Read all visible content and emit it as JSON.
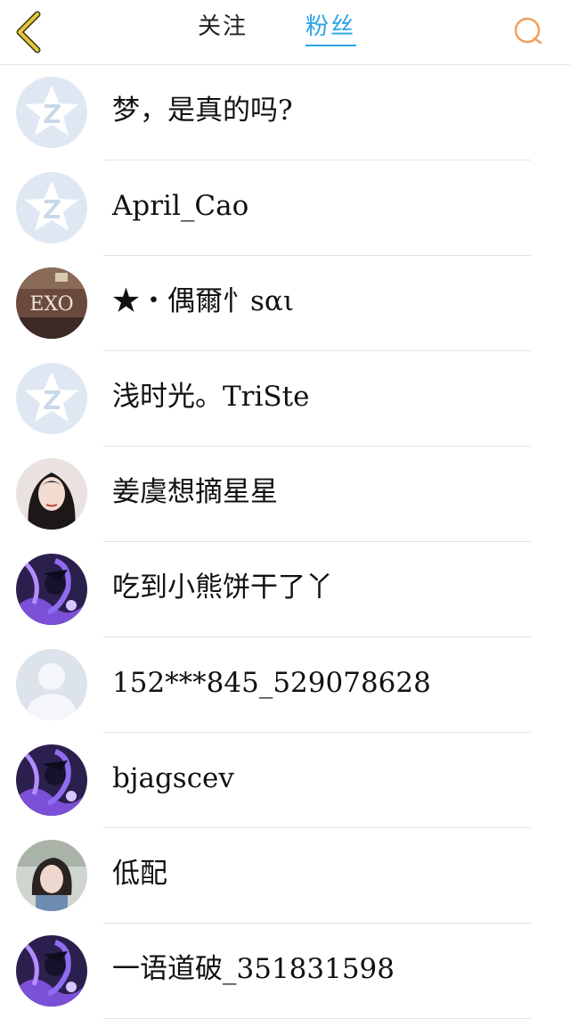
{
  "header": {
    "back_icon": "chevron-left-icon",
    "tabs": [
      {
        "label": "关注",
        "active": false
      },
      {
        "label": "粉丝",
        "active": true
      }
    ],
    "search_icon": "search-icon",
    "accent_color": "#2aa3e6",
    "back_color": "#e8c53a",
    "search_color": "#f0a060"
  },
  "fans": [
    {
      "name": "梦，是真的吗?",
      "avatar": "default-qq-star-avatar"
    },
    {
      "name": "April_Cao",
      "avatar": "default-qq-star-avatar"
    },
    {
      "name": "★・偶爾忄sαι",
      "avatar": "exo-photo-avatar"
    },
    {
      "name": "浅时光。TriSte",
      "avatar": "default-qq-star-avatar"
    },
    {
      "name": "姜虞想摘星星",
      "avatar": "girl-portrait-avatar"
    },
    {
      "name": "吃到小熊饼干了丫",
      "avatar": "anime-purple-avatar"
    },
    {
      "name": "152***845_529078628",
      "avatar": "default-person-avatar"
    },
    {
      "name": "bjagscev",
      "avatar": "anime-purple-avatar"
    },
    {
      "name": "低配",
      "avatar": "girl-selfie-avatar"
    },
    {
      "name": "一语道破_351831598",
      "avatar": "anime-purple-avatar"
    }
  ]
}
